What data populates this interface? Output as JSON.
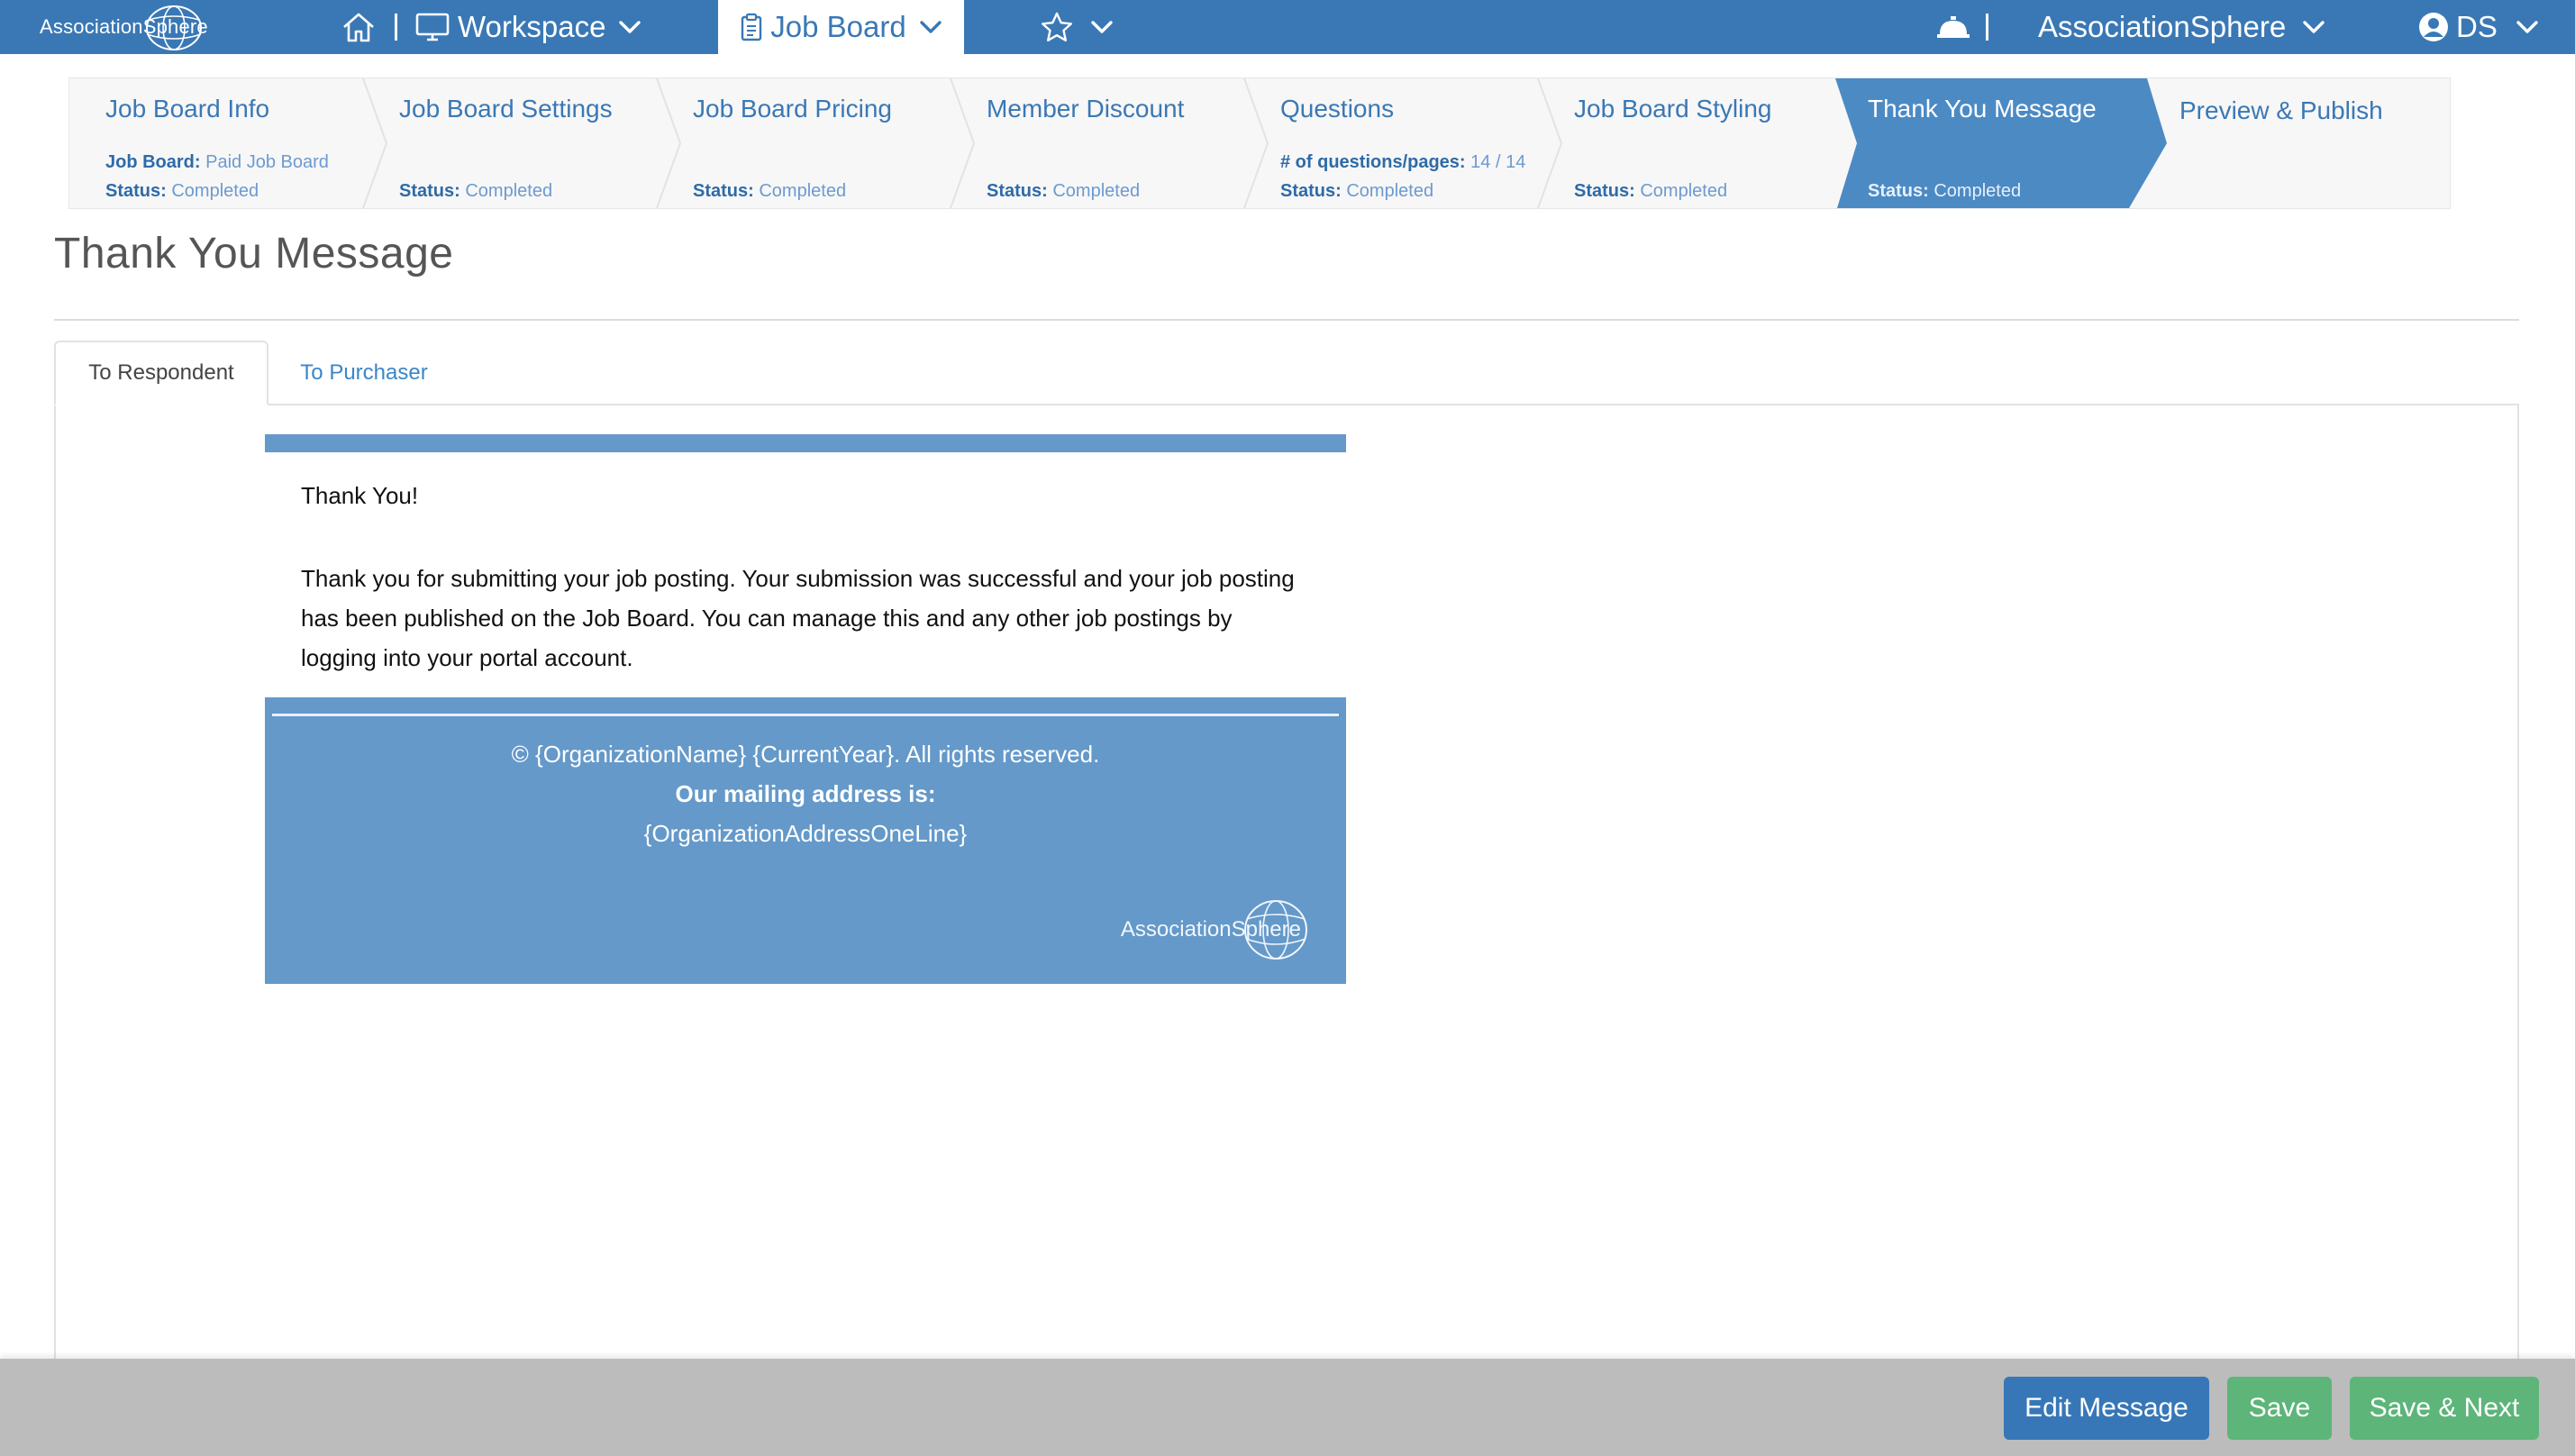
{
  "nav": {
    "logo_text": "AssociationSphere",
    "workspace_label": "Workspace",
    "jobboard_label": "Job Board",
    "org_label": "AssociationSphere",
    "user_initials": "DS"
  },
  "steps": [
    {
      "title": "Job Board Info",
      "line1_label": "Job Board:",
      "line1_value": "Paid Job Board",
      "line2_label": "Status:",
      "line2_value": "Completed"
    },
    {
      "title": "Job Board Settings",
      "line2_label": "Status:",
      "line2_value": "Completed"
    },
    {
      "title": "Job Board Pricing",
      "line2_label": "Status:",
      "line2_value": "Completed"
    },
    {
      "title": "Member Discount",
      "line2_label": "Status:",
      "line2_value": "Completed"
    },
    {
      "title": "Questions",
      "line1_label": "# of questions/pages:",
      "line1_value": "14 / 14",
      "line2_label": "Status:",
      "line2_value": "Completed"
    },
    {
      "title": "Job Board Styling",
      "line2_label": "Status:",
      "line2_value": "Completed"
    },
    {
      "title": "Thank You Message",
      "line2_label": "Status:",
      "line2_value": "Completed"
    },
    {
      "title": "Preview & Publish"
    }
  ],
  "page": {
    "title": "Thank You Message"
  },
  "tabs": {
    "respondent": "To Respondent",
    "purchaser": "To Purchaser"
  },
  "email": {
    "greeting": "Thank You!",
    "paragraph": "Thank you for submitting your job posting. Your submission was successful and your job posting has been published on the Job Board. You can manage this and any other job postings by logging into your portal account.",
    "footer_copyright": "© {OrganizationName} {CurrentYear}. All rights reserved.",
    "footer_mailing_label": "Our mailing address is:",
    "footer_address": "{OrganizationAddressOneLine}",
    "footer_logo_text": "AssociationSphere"
  },
  "actions": {
    "edit": "Edit Message",
    "save": "Save",
    "save_next": "Save & Next"
  },
  "colors": {
    "primary": "#3a78b5",
    "email_blue": "#6499c9",
    "success": "#5db579",
    "link": "#3a86c8"
  }
}
